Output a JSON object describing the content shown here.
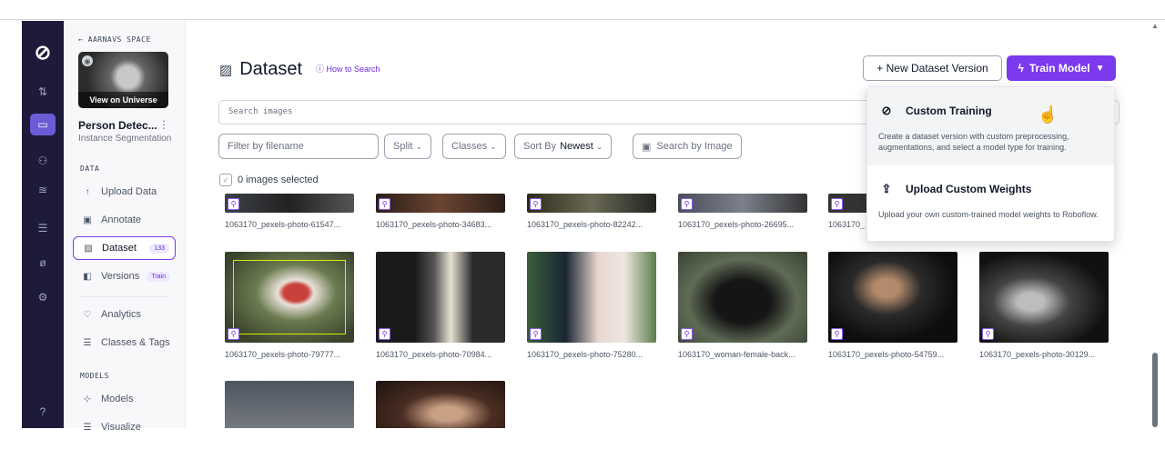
{
  "rail": {
    "icons": [
      "logo-icon",
      "sort-icon",
      "dataset-icon",
      "graph-icon",
      "workflow-icon",
      "deploy-icon",
      "edit-icon",
      "settings-icon",
      "help-icon"
    ]
  },
  "sidebar": {
    "back_label": "AARNAVS SPACE",
    "thumb_label": "View on Universe",
    "project_name": "Person Detec...",
    "project_type": "Instance Segmentation",
    "data_section": "DATA",
    "models_section": "MODELS",
    "items": [
      {
        "label": "Upload Data",
        "icon": "↑"
      },
      {
        "label": "Annotate",
        "icon": "▣"
      },
      {
        "label": "Dataset",
        "icon": "▨",
        "badge": "133"
      },
      {
        "label": "Versions",
        "icon": "◧",
        "badge": "Train"
      },
      {
        "label": "Analytics",
        "icon": "♡"
      },
      {
        "label": "Classes & Tags",
        "icon": "☰"
      },
      {
        "label": "Models",
        "icon": "⊹"
      },
      {
        "label": "Visualize",
        "icon": "☰"
      }
    ]
  },
  "header": {
    "title": "Dataset",
    "how_to_search": "How to Search",
    "new_version": "+ New Dataset Version",
    "train_model": "Train Model"
  },
  "search": {
    "placeholder": "Search images"
  },
  "filters": {
    "filename_placeholder": "Filter by filename",
    "split": "Split",
    "classes": "Classes",
    "sort_by": "Sort By",
    "sort_value": "Newest",
    "search_by_image": "Search by Image"
  },
  "selection": {
    "label": "0 images selected"
  },
  "images": [
    {
      "filename": "1063170_pexels-photo-61547..."
    },
    {
      "filename": "1063170_pexels-photo-34683..."
    },
    {
      "filename": "1063170_pexels-photo-82242..."
    },
    {
      "filename": "1063170_pexels-photo-26695..."
    },
    {
      "filename": "1063170_"
    },
    {
      "filename": "1063170_pexels-photo-79777..."
    },
    {
      "filename": "1063170_pexels-photo-70984..."
    },
    {
      "filename": "1063170_pexels-photo-75280..."
    },
    {
      "filename": "1063170_woman-female-back..."
    },
    {
      "filename": "1063170_pexels-photo-54759..."
    },
    {
      "filename": "1063170_pexels-photo-30129..."
    },
    {
      "filename": ""
    },
    {
      "filename": ""
    }
  ],
  "dropdown": {
    "custom_training_title": "Custom Training",
    "custom_training_desc": "Create a dataset version with custom preprocessing, augmentations, and select a model type for training.",
    "upload_weights_title": "Upload Custom Weights",
    "upload_weights_desc": "Upload your own custom-trained model weights to Roboflow."
  },
  "colors": {
    "accent": "#7c3aed",
    "rail": "#1e1b3a",
    "annotation": "#d4f000"
  }
}
